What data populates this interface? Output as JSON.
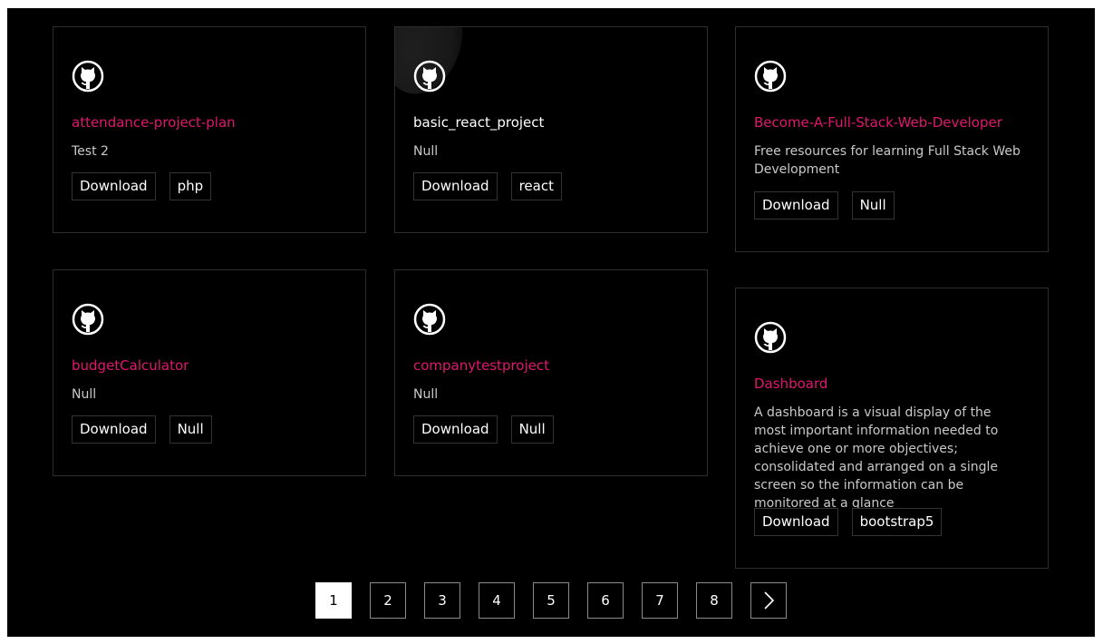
{
  "repos": [
    {
      "name": "attendance-project-plan",
      "description": "Test 2",
      "download_label": "Download",
      "tag": "php"
    },
    {
      "name": "basic_react_project",
      "description": "Null",
      "download_label": "Download",
      "tag": "react"
    },
    {
      "name": "Become-A-Full-Stack-Web-Developer",
      "description": "Free resources for learning Full Stack Web Development",
      "download_label": "Download",
      "tag": "Null"
    },
    {
      "name": "budgetCalculator",
      "description": "Null",
      "download_label": "Download",
      "tag": "Null"
    },
    {
      "name": "companytestproject",
      "description": "Null",
      "download_label": "Download",
      "tag": "Null"
    },
    {
      "name": "Dashboard",
      "description": "A dashboard is a visual display of the most important information needed to achieve one or more objectives; consolidated and arranged on a single screen so the information can be monitored at a glance",
      "download_label": "Download",
      "tag": "bootstrap5"
    }
  ],
  "card_icon": "github-icon",
  "pagination": {
    "pages": [
      "1",
      "2",
      "3",
      "4",
      "5",
      "6",
      "7",
      "8"
    ],
    "active": "1",
    "next_icon": "chevron-right-icon"
  },
  "colors": {
    "background": "#000000",
    "accent": "#e1166f",
    "text": "#ffffff",
    "muted": "#c9c9c9",
    "border": "#2d2d2d"
  }
}
